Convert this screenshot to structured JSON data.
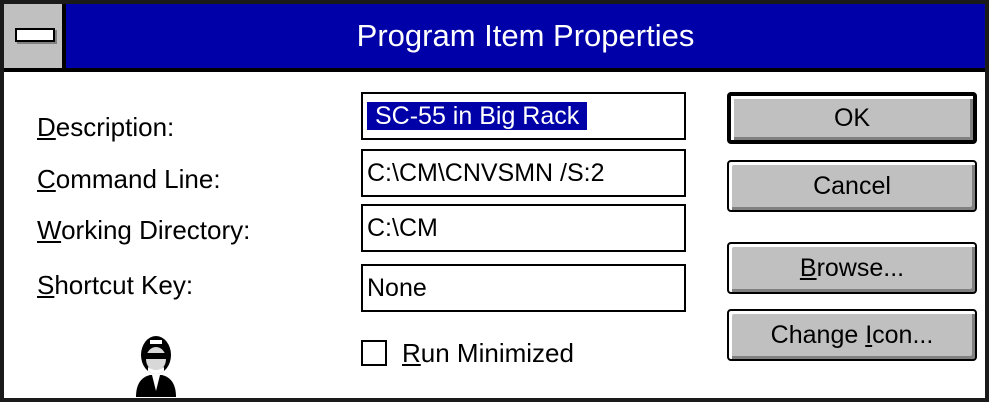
{
  "window": {
    "title": "Program Item Properties",
    "system_menu_icon": "system-menu-icon"
  },
  "fields": {
    "description": {
      "label_mnemonic": "D",
      "label_rest": "escription:",
      "value": "SC-55 in Big Rack"
    },
    "command_line": {
      "label_mnemonic": "C",
      "label_rest": "ommand Line:",
      "value": "C:\\CM\\CNVSMN /S:2"
    },
    "working_directory": {
      "label_mnemonic": "W",
      "label_rest": "orking Directory:",
      "value": "C:\\CM"
    },
    "shortcut_key": {
      "label_mnemonic": "S",
      "label_rest": "hortcut Key:",
      "value": "None"
    }
  },
  "run_minimized": {
    "label_mnemonic": "R",
    "label_rest": "un Minimized",
    "checked": false
  },
  "buttons": {
    "ok": "OK",
    "cancel": "Cancel",
    "browse_mnemonic": "B",
    "browse_rest": "rowse...",
    "change_icon_before": "Change ",
    "change_icon_mnemonic": "I",
    "change_icon_after": "con..."
  },
  "program_icon": "person-portrait-icon",
  "colors": {
    "titlebar": "#0000a8",
    "button_face": "#c0c0c0",
    "selection": "#0000a8"
  }
}
